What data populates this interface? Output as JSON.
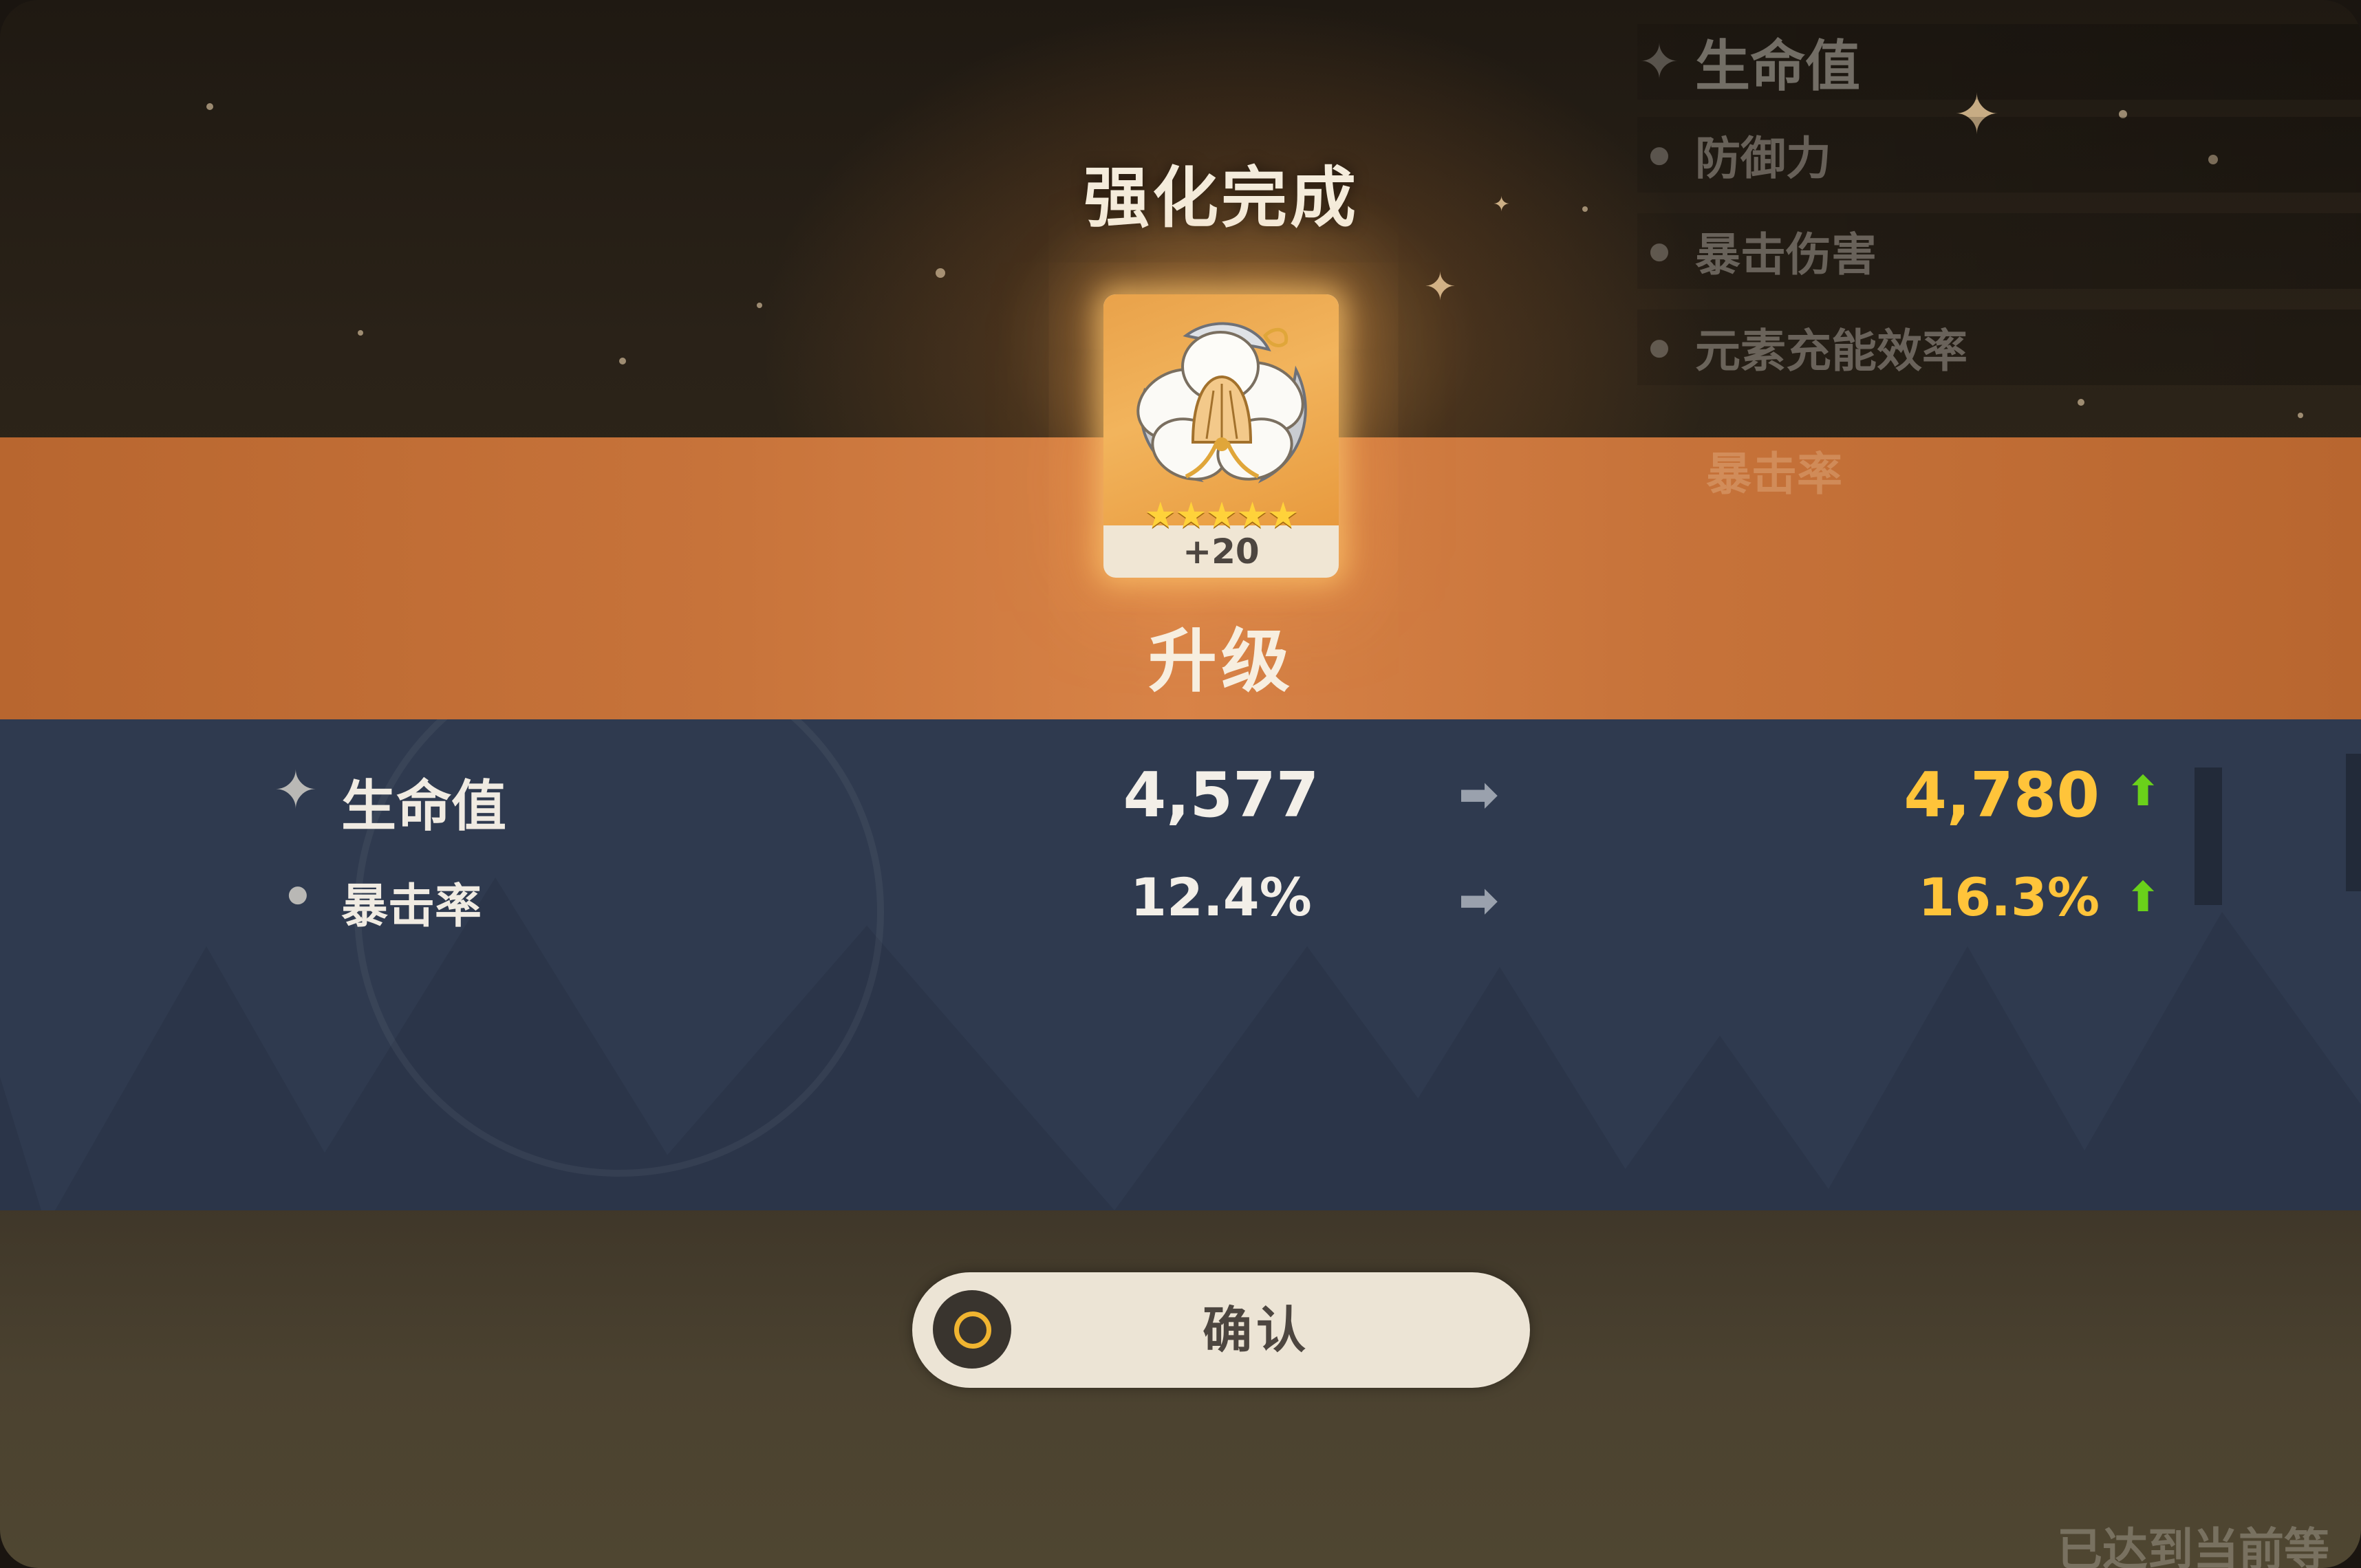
{
  "header": {
    "title": "强化完成"
  },
  "background_stat_list": [
    {
      "label": "生命值",
      "marker": "sparkle-icon"
    },
    {
      "label": "防御力",
      "marker": "dot-icon"
    },
    {
      "label": "暴击伤害",
      "marker": "dot-icon"
    },
    {
      "label": "元素充能效率",
      "marker": "dot-icon"
    },
    {
      "label": "暴击率",
      "marker": "dot-icon"
    }
  ],
  "item": {
    "level": "+20",
    "stars": "★★★★★",
    "rarity": 5,
    "icon": "flower-artifact-icon"
  },
  "result_label": "升级",
  "stats": [
    {
      "label": "生命值",
      "old": "4,577",
      "new": "4,780",
      "icon": "sparkle-icon",
      "arrow": "➡",
      "up": "⬆"
    },
    {
      "label": "暴击率",
      "old": "12.4%",
      "new": "16.3%",
      "icon": "dot-icon",
      "arrow": "➡",
      "up": "⬆"
    }
  ],
  "confirm_button": {
    "label": "确认",
    "icon": "ring-icon"
  },
  "footer_hint": "已达到当前等",
  "colors": {
    "accent_orange": "#d88347",
    "panel_blue": "#2f3a4f",
    "new_value": "#ffc43a",
    "increase_arrow": "#6ad11a",
    "button_bg": "#ece4d5",
    "button_ring": "#f0b430"
  }
}
